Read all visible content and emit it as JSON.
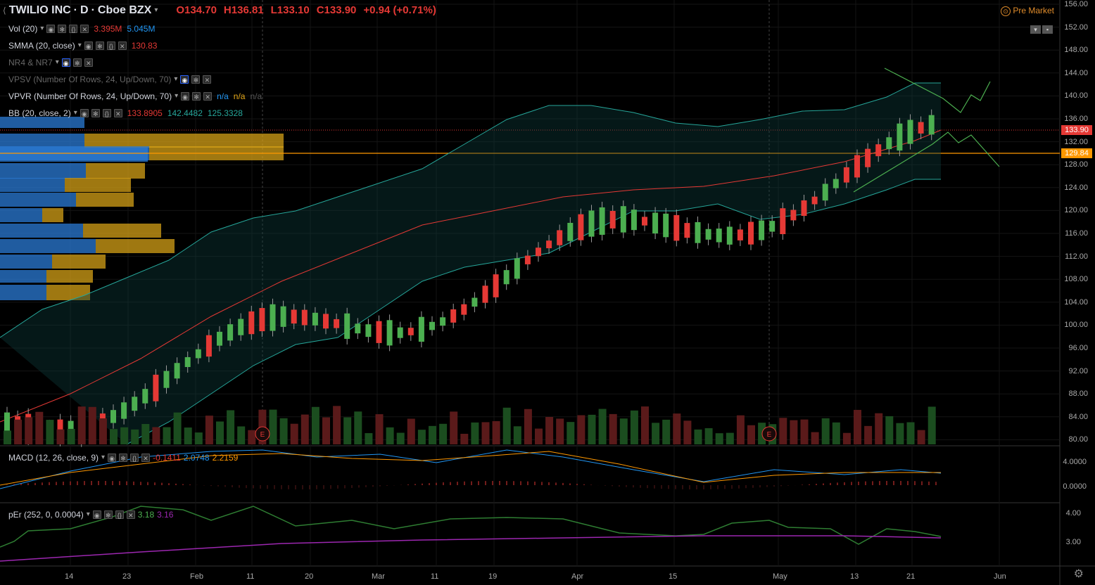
{
  "header": {
    "symbol": "TWILIO INC",
    "sep1": "·",
    "interval": "D",
    "sep2": "·",
    "exchange": "Cboe BZX",
    "open": "O134.70",
    "high": "H136.81",
    "low": "L133.10",
    "close": "C133.90",
    "change": "+0.94 (+0.71%)",
    "premarket": "Pre Market"
  },
  "indicators": [
    {
      "label": "Vol (20)",
      "values": [
        {
          "text": "3.395M",
          "color": "#e53935"
        },
        {
          "text": "5.045M",
          "color": "#2196f3"
        }
      ],
      "buttons": [
        "eye",
        "gear",
        "brackets",
        "close"
      ],
      "muted": false
    },
    {
      "label": "SMMA (20, close)",
      "values": [
        {
          "text": "130.83",
          "color": "#e53935"
        }
      ],
      "buttons": [
        "eye",
        "gear",
        "brackets",
        "close"
      ],
      "muted": false
    },
    {
      "label": "NR4 & NR7",
      "values": [],
      "buttons": [
        "eye-blue",
        "gear",
        "close"
      ],
      "muted": true
    },
    {
      "label": "VPSV (Number Of Rows, 24, Up/Down, 70)",
      "values": [],
      "buttons": [
        "eye-blue",
        "gear",
        "close"
      ],
      "muted": true
    },
    {
      "label": "VPVR (Number Of Rows, 24, Up/Down, 70)",
      "values": [
        {
          "text": "n/a",
          "color": "#2196f3"
        },
        {
          "text": "n/a",
          "color": "#e6a817"
        },
        {
          "text": "n/a",
          "color": "#555"
        }
      ],
      "buttons": [
        "eye",
        "gear",
        "close"
      ],
      "muted": false
    },
    {
      "label": "BB (20, close, 2)",
      "values": [
        {
          "text": "133.8905",
          "color": "#e53935"
        },
        {
          "text": "142.4482",
          "color": "#26a69a"
        },
        {
          "text": "125.3328",
          "color": "#26a69a"
        }
      ],
      "buttons": [
        "eye",
        "gear",
        "brackets",
        "close"
      ],
      "muted": false
    }
  ],
  "macd": {
    "label": "MACD (12, 26, close, 9)",
    "values": [
      {
        "text": "-0.1411",
        "color": "#e53935"
      },
      {
        "text": "2.0748",
        "color": "#2196f3"
      },
      {
        "text": "2.2159",
        "color": "#ff9800"
      }
    ],
    "axis": [
      "4.0000",
      "0.0000"
    ]
  },
  "per": {
    "label": "pEr (252, 0, 0.0004)",
    "values": [
      {
        "text": "3.18",
        "color": "#4caf50"
      },
      {
        "text": "3.16",
        "color": "#9c27b0"
      }
    ],
    "axis": [
      "4.00",
      "3.00"
    ]
  },
  "price_axis": [
    "156.00",
    "152.00",
    "148.00",
    "144.00",
    "140.00",
    "136.00",
    "132.00",
    "128.00",
    "124.00",
    "120.00",
    "116.00",
    "112.00",
    "108.00",
    "104.00",
    "100.00",
    "96.00",
    "92.00",
    "88.00",
    "84.00",
    "80.00"
  ],
  "price_tags": [
    {
      "text": "133.90",
      "color": "#e53935"
    },
    {
      "text": "129.84",
      "color": "#ff9800"
    }
  ],
  "time_axis": [
    "14",
    "23",
    "Feb",
    "11",
    "20",
    "Mar",
    "11",
    "19",
    "Apr",
    "15",
    "May",
    "13",
    "21",
    "Jun"
  ],
  "earnings_markers": [
    "E",
    "E"
  ],
  "colors": {
    "up": "#4caf50",
    "down": "#e53935",
    "background": "#000000",
    "bb": "#26a69a",
    "smma": "#e53935"
  },
  "icons": {
    "premarket": "clock-icon",
    "settings": "gear-icon"
  }
}
